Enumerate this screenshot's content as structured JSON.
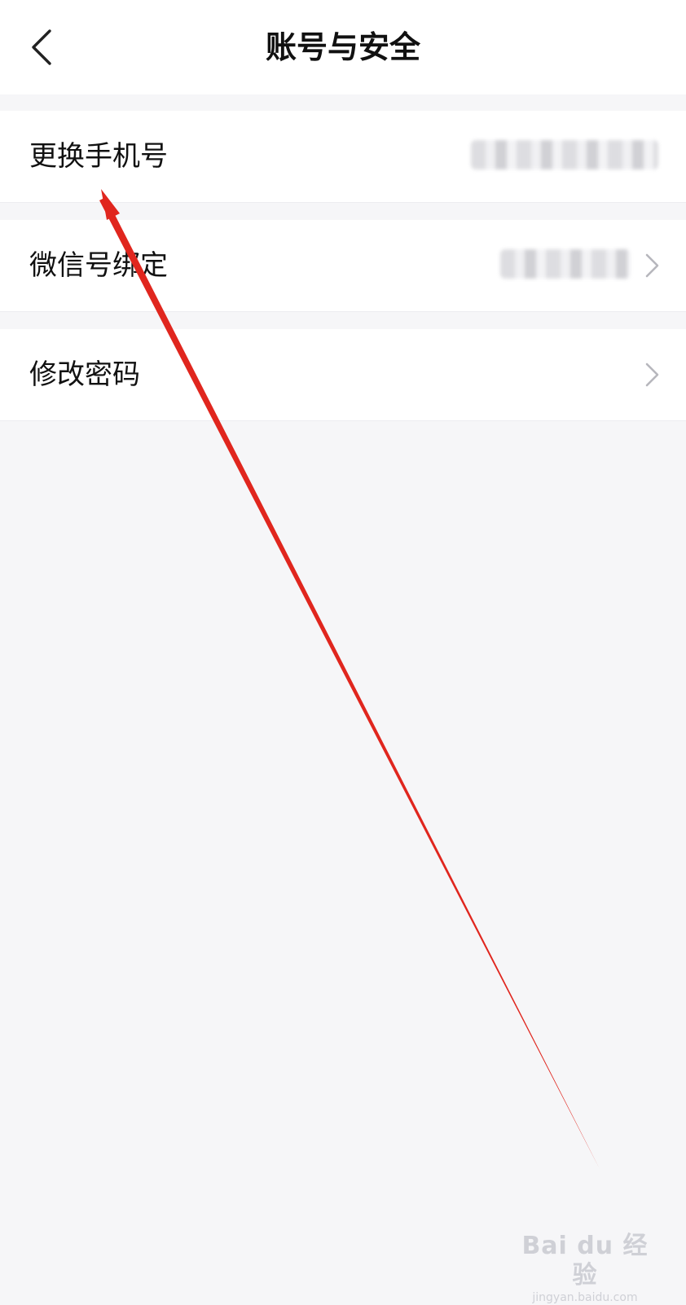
{
  "header": {
    "title": "账号与安全",
    "back_icon": "chevron-left-icon"
  },
  "rows": [
    {
      "label": "更换手机号",
      "value": "[blurred phone number]",
      "chevron_icon": "chevron-right-icon"
    },
    {
      "label": "微信号绑定",
      "value": "[blurred wechat id]",
      "chevron_icon": "chevron-right-icon"
    },
    {
      "label": "修改密码",
      "chevron_icon": "chevron-right-icon"
    }
  ],
  "colors": {
    "background": "#f6f6f8",
    "card": "#ffffff",
    "text": "#111111",
    "chevron": "#b7b7bd",
    "annotation": "#e0261e",
    "watermark": "#cfd0d6"
  },
  "watermark": {
    "brand": "Bai du 经验",
    "url": "jingyan.baidu.com"
  }
}
